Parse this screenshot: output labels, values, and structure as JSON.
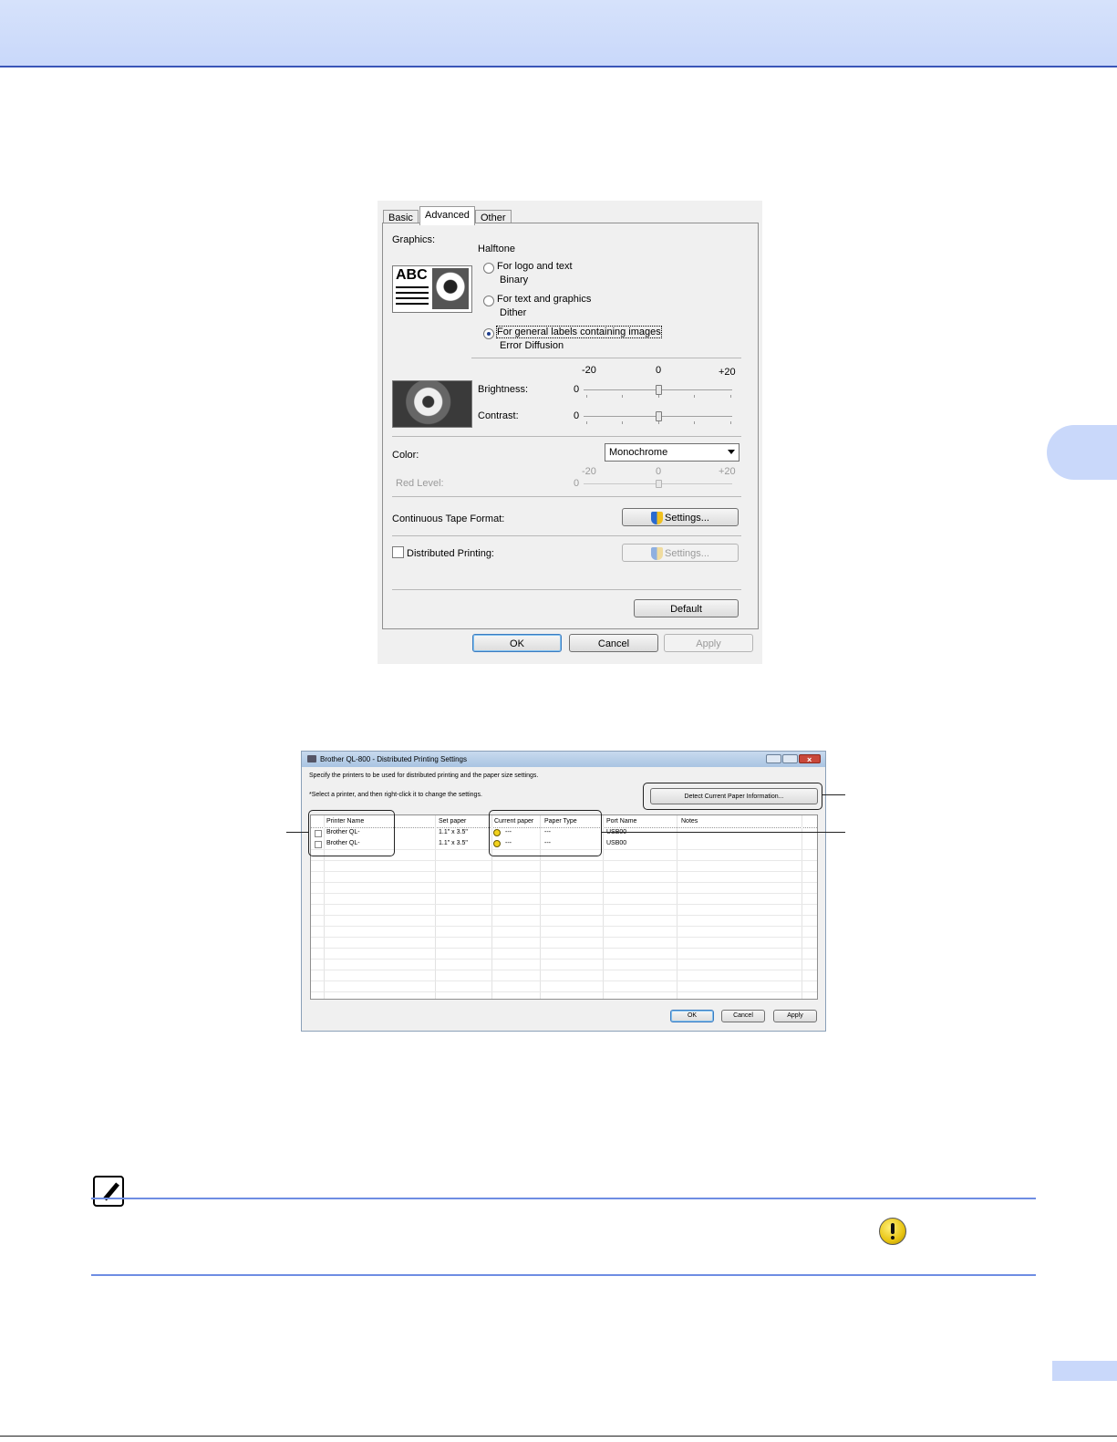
{
  "dialog_advanced": {
    "tabs": [
      "Basic",
      "Advanced",
      "Other"
    ],
    "active_tab": "Advanced",
    "graphics_label": "Graphics:",
    "halftone_label": "Halftone",
    "thumbnail_text": "ABC",
    "options": [
      {
        "label": "For logo and text",
        "sub": "Binary",
        "selected": false
      },
      {
        "label": "For text and graphics",
        "sub": "Dither",
        "selected": false
      },
      {
        "label": "For general labels containing images",
        "sub": "Error Diffusion",
        "selected": true
      }
    ],
    "scale": {
      "min": "-20",
      "mid": "0",
      "max": "+20"
    },
    "brightness": {
      "label": "Brightness:",
      "value": "0"
    },
    "contrast": {
      "label": "Contrast:",
      "value": "0"
    },
    "color": {
      "label": "Color:",
      "selected": "Monochrome"
    },
    "red_level": {
      "label": "Red Level:",
      "value": "0",
      "min": "-20",
      "mid": "0",
      "max": "+20"
    },
    "continuous_tape": {
      "label": "Continuous Tape Format:",
      "button": "Settings..."
    },
    "distributed": {
      "label": "Distributed Printing:",
      "checked": false,
      "button": "Settings..."
    },
    "default_button": "Default",
    "ok_button": "OK",
    "cancel_button": "Cancel",
    "apply_button": "Apply"
  },
  "dialog_distributed": {
    "title": "Brother QL-800 - Distributed Printing Settings",
    "instruction1": "Specify the printers to be used for distributed printing and the paper size settings.",
    "instruction2": "*Select a printer, and then right-click it to change the settings.",
    "detect_button": "Detect Current Paper Information...",
    "columns": [
      "Printer Name",
      "Set paper",
      "Current paper",
      "Paper Type",
      "Port Name",
      "Notes"
    ],
    "rows": [
      {
        "printer": "Brother QL-",
        "set_paper": "1.1\" x 3.5\"",
        "current_paper": "---",
        "paper_type": "---",
        "port": "USB00",
        "notes": ""
      },
      {
        "printer": "Brother QL-",
        "set_paper": "1.1\" x 3.5\"",
        "current_paper": "---",
        "paper_type": "---",
        "port": "USB00",
        "notes": ""
      }
    ],
    "ok_button": "OK",
    "cancel_button": "Cancel",
    "apply_button": "Apply"
  },
  "colors": {
    "header_bg": "#c9d8fa",
    "header_rule": "#3a55b8",
    "note_rule": "#6e8de3",
    "warning": "#f2d21c"
  }
}
